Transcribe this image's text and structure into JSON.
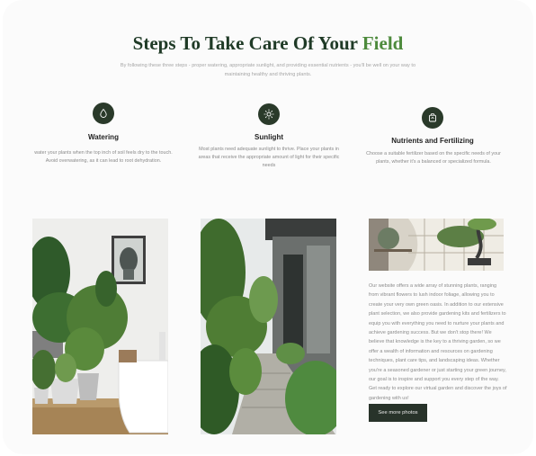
{
  "header": {
    "title_main": "Steps To Take Care Of Your ",
    "title_accent": "Field",
    "subtitle": "By following these three steps - proper watering, appropriate sunlight, and providing essential nutrients - you'll be well on your way to maintaining healthy and thriving plants."
  },
  "steps": [
    {
      "icon": "water-drop-icon",
      "title": "Watering",
      "text": "water your plants when the top inch of soil feels dry to the touch. Avoid overwatering, as it can lead to root  dehydration."
    },
    {
      "icon": "sun-icon",
      "title": "Sunlight",
      "text": "Most plants need adequate sunlight to thrive. Place your plants in areas that receive the appropriate amount of light for their specific needs"
    },
    {
      "icon": "nutrient-bag-icon",
      "title": "Nutrients and Fertilizing",
      "text": "Choose a suitable fertilizer based on the specific needs of your plants, whether it's a balanced or specialized formula."
    }
  ],
  "about": {
    "text": "Our website offers a wide array of stunning plants, ranging from vibrant flowers to lush indoor foliage, allowing you to create your very own green oasis. In addition to our extensive plant selection, we also provide gardening kits and fertilizers to equip you with everything you need to nurture your plants and achieve gardening success. But we don't stop there! We believe that knowledge is the key to a thriving garden, so we offer a wealth of information and resources on gardening techniques, plant care tips, and landscaping ideas. Whether you're a seasoned gardener or just starting your green journey, our goal is to inspire and support you every step of the way. Get ready to explore our virtual garden and discover the joys of gardening with us!",
    "button_label": "See more photos"
  },
  "colors": {
    "title": "#1f3a26",
    "accent": "#4d8a3c",
    "icon_bg": "#2a3a2a",
    "button_bg": "#28332a"
  }
}
